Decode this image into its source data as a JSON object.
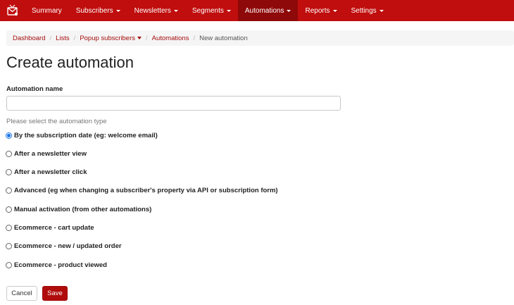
{
  "navbar": {
    "logo_icon": "app-logo-icon",
    "items": [
      {
        "label": "Summary",
        "dropdown": false,
        "active": false
      },
      {
        "label": "Subscribers",
        "dropdown": true,
        "active": false
      },
      {
        "label": "Newsletters",
        "dropdown": true,
        "active": false
      },
      {
        "label": "Segments",
        "dropdown": true,
        "active": false
      },
      {
        "label": "Automations",
        "dropdown": true,
        "active": true
      },
      {
        "label": "Reports",
        "dropdown": true,
        "active": false
      },
      {
        "label": "Settings",
        "dropdown": true,
        "active": false
      }
    ]
  },
  "breadcrumb": {
    "items": [
      {
        "label": "Dashboard"
      },
      {
        "label": "Lists"
      },
      {
        "label": "Popup subscribers"
      },
      {
        "label": "Automations"
      },
      {
        "label": "New automation"
      }
    ]
  },
  "page": {
    "title": "Create automation"
  },
  "form": {
    "name_label": "Automation name",
    "name_value": "",
    "type_hint": "Please select the automation type",
    "options": [
      {
        "label": "By the subscription date (eg: welcome email)",
        "checked": true
      },
      {
        "label": "After a newsletter view",
        "checked": false
      },
      {
        "label": "After a newsletter click",
        "checked": false
      },
      {
        "label": "Advanced (eg when changing a subscriber's property via API or subscription form)",
        "checked": false
      },
      {
        "label": "Manual activation (from other automations)",
        "checked": false
      },
      {
        "label": "Ecommerce - cart update",
        "checked": false
      },
      {
        "label": "Ecommerce - new / updated order",
        "checked": false
      },
      {
        "label": "Ecommerce - product viewed",
        "checked": false
      }
    ],
    "cancel_label": "Cancel",
    "save_label": "Save"
  },
  "colors": {
    "navbar_bg": "#c00d0d",
    "navbar_active_bg": "#8e0909",
    "link": "#a40d0d",
    "save_bg": "#b00c0c",
    "radio_checked": "#1a73e8"
  }
}
